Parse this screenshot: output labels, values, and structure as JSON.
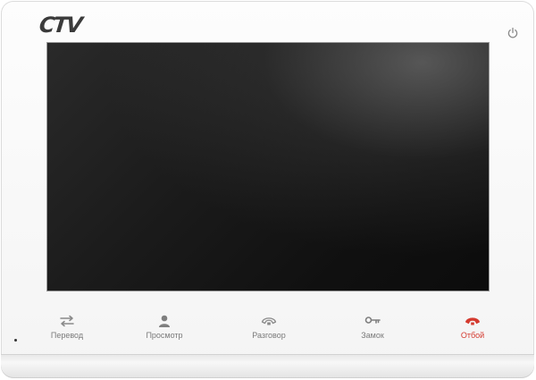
{
  "device": {
    "brand": "CTV",
    "colors": {
      "body": "#f6f6f6",
      "screen": "#141414",
      "label": "#7a7a7a",
      "icon": "#8a8a8a",
      "end_call": "#d43a2f"
    }
  },
  "status": {
    "power_icon": "power-icon"
  },
  "buttons": [
    {
      "id": "transfer",
      "label": "Перевод",
      "icon": "transfer-arrows-icon"
    },
    {
      "id": "monitor",
      "label": "Просмотр",
      "icon": "person-icon"
    },
    {
      "id": "talk",
      "label": "Разговор",
      "icon": "phone-handset-icon"
    },
    {
      "id": "lock",
      "label": "Замок",
      "icon": "key-icon"
    },
    {
      "id": "hangup",
      "label": "Отбой",
      "icon": "hangup-phone-icon"
    }
  ]
}
